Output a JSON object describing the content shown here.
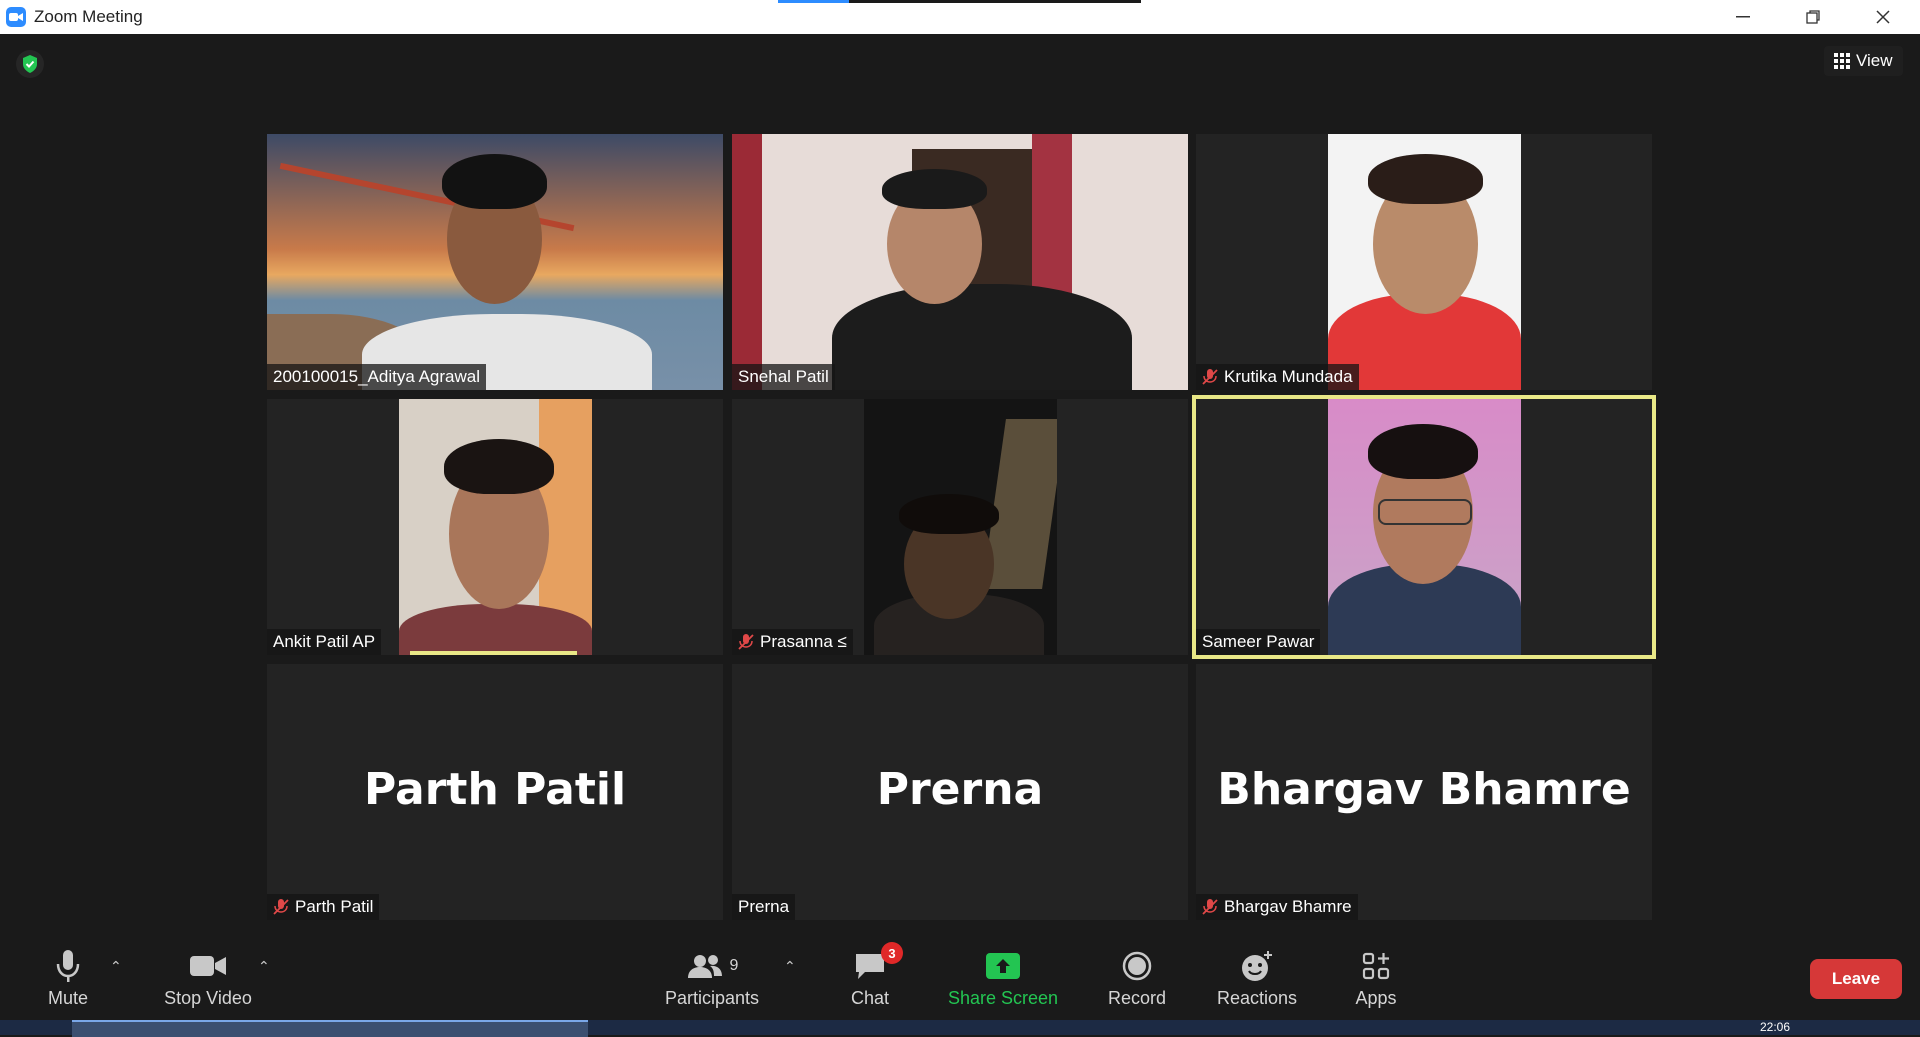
{
  "window": {
    "title": "Zoom Meeting",
    "minimize_icon": "minimize-icon",
    "restore_icon": "restore-icon",
    "close_icon": "close-icon"
  },
  "top": {
    "security_icon": "shield-check-icon",
    "view_label": "View"
  },
  "participants_grid": [
    {
      "name": "200100015_Aditya Agrawal",
      "muted": false,
      "video": true,
      "active": false
    },
    {
      "name": "Snehal Patil",
      "muted": false,
      "video": true,
      "active": false
    },
    {
      "name": "Krutika Mundada",
      "muted": true,
      "video": true,
      "active": false
    },
    {
      "name": "Ankit Patil AP",
      "muted": false,
      "video": true,
      "active": false
    },
    {
      "name": "Prasanna ≤",
      "muted": true,
      "video": true,
      "active": false
    },
    {
      "name": "Sameer Pawar",
      "muted": false,
      "video": true,
      "active": true
    },
    {
      "name": "Parth Patil",
      "display_name": "Parth Patil",
      "muted": true,
      "video": false,
      "active": false
    },
    {
      "name": "Prerna",
      "display_name": "Prerna",
      "muted": false,
      "video": false,
      "active": false
    },
    {
      "name": "Bhargav Bhamre",
      "display_name": "Bhargav Bhamre",
      "muted": true,
      "video": false,
      "active": false
    }
  ],
  "toolbar": {
    "mute_label": "Mute",
    "stop_video_label": "Stop Video",
    "participants_label": "Participants",
    "participants_count": "9",
    "chat_label": "Chat",
    "chat_badge": "3",
    "share_screen_label": "Share Screen",
    "record_label": "Record",
    "reactions_label": "Reactions",
    "apps_label": "Apps",
    "leave_label": "Leave"
  },
  "colors": {
    "accent_blue": "#2d8cff",
    "share_green": "#23c552",
    "leave_red": "#d63838",
    "active_speaker": "#e9e887",
    "muted_red": "#e04848"
  },
  "taskbar": {
    "clock": "22:06"
  }
}
